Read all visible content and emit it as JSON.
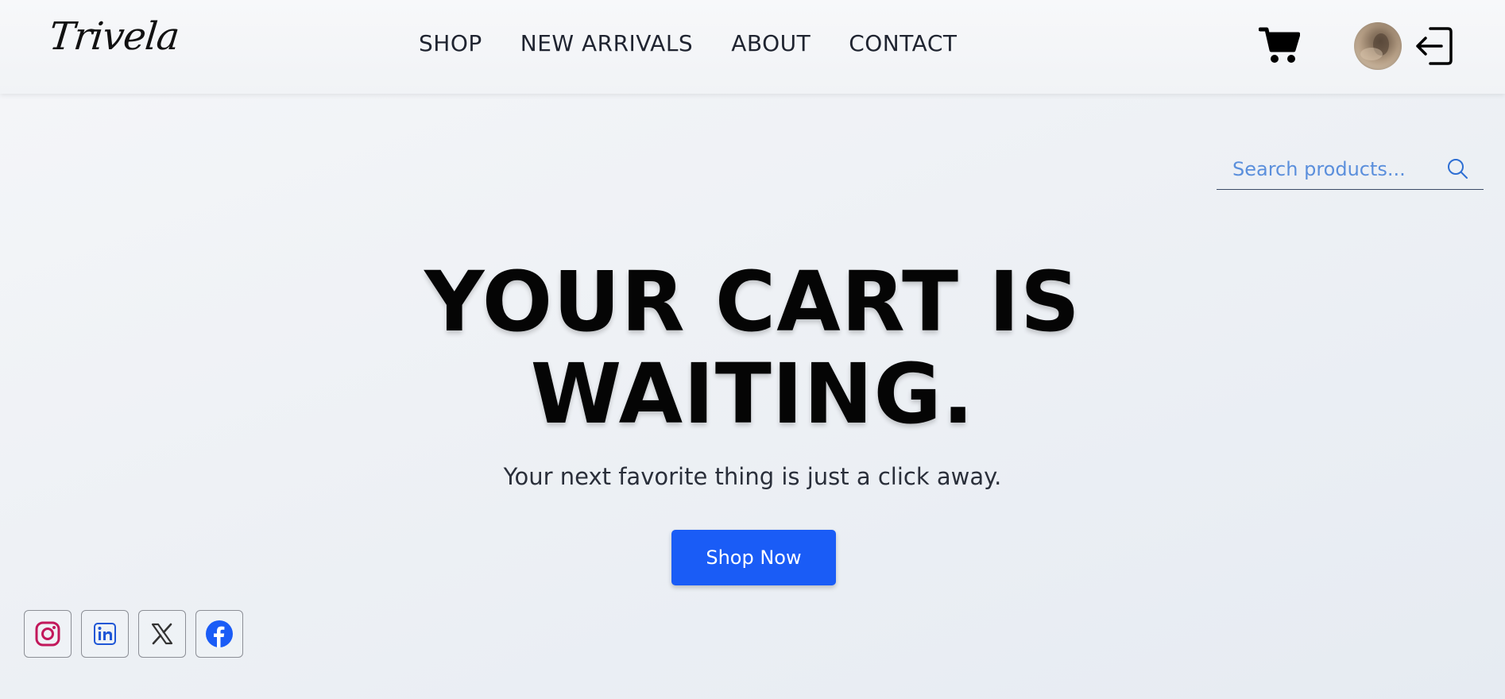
{
  "header": {
    "logo": "Trivela",
    "nav": [
      "SHOP",
      "NEW ARRIVALS",
      "ABOUT",
      "CONTACT"
    ]
  },
  "search": {
    "placeholder": "Search products..."
  },
  "hero": {
    "title_line1": "YOUR CART IS",
    "title_line2": "WAITING.",
    "subtitle": "Your next favorite thing is just a click away.",
    "cta": "Shop Now"
  },
  "icons": {
    "cart": "cart-icon",
    "avatar": "user-avatar",
    "login": "login-icon",
    "search": "search-icon"
  },
  "socials": [
    {
      "name": "instagram-icon",
      "color": "#c2185b"
    },
    {
      "name": "linkedin-icon",
      "color": "#1e56d6"
    },
    {
      "name": "x-icon",
      "color": "#333333"
    },
    {
      "name": "facebook-icon",
      "color": "#1a5cf6"
    }
  ],
  "colors": {
    "accent": "#1a5cf6",
    "search_text": "#5b8fdc"
  }
}
